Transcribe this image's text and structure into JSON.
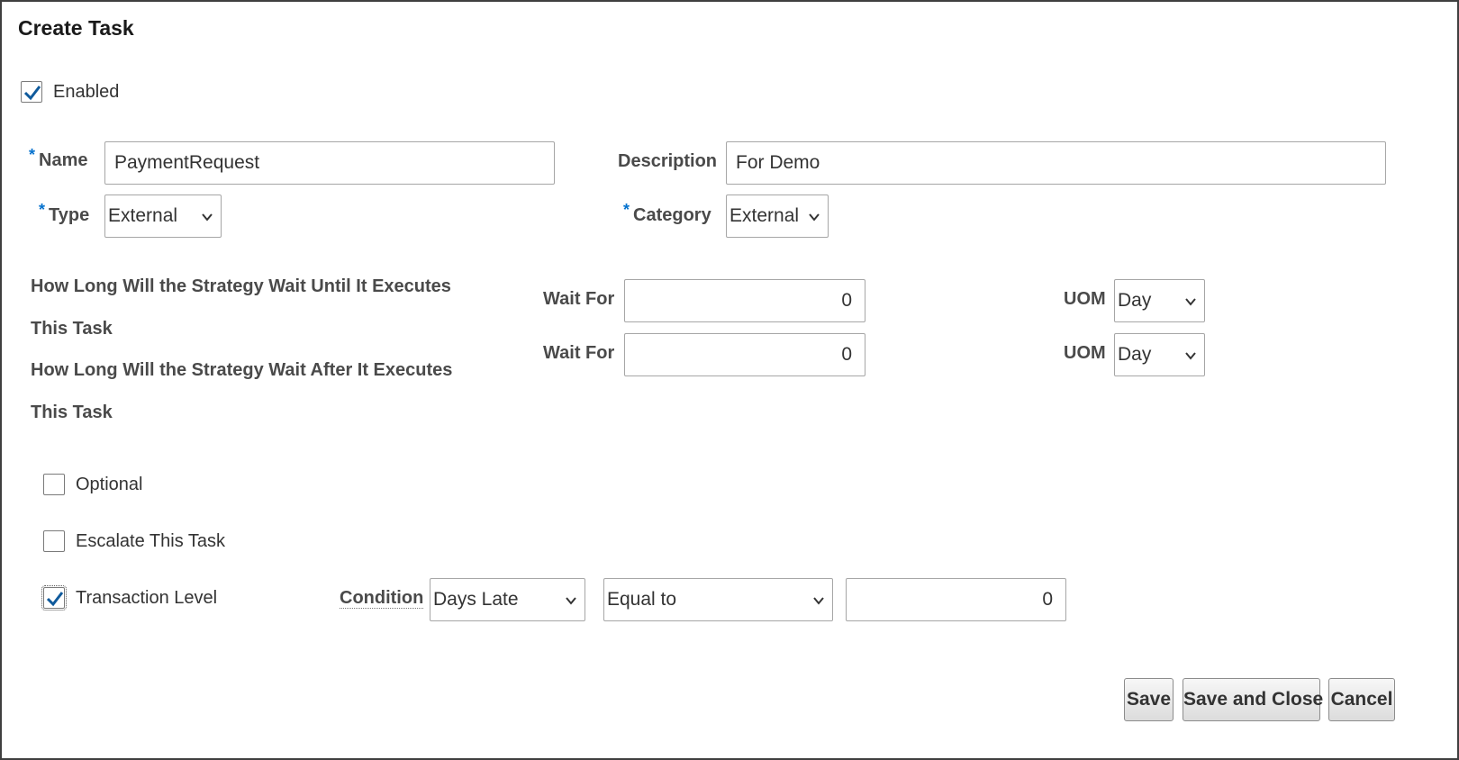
{
  "dialog": {
    "title": "Create Task"
  },
  "enabled": {
    "label": "Enabled",
    "checked": true
  },
  "name": {
    "label": "Name",
    "value": "PaymentRequest"
  },
  "description": {
    "label": "Description",
    "value": "For Demo"
  },
  "type": {
    "label": "Type",
    "value": "External"
  },
  "category": {
    "label": "Category",
    "value": "External"
  },
  "wait_before": {
    "text_line1": "How Long Will the Strategy Wait Until It Executes",
    "text_line2": "This Task",
    "wait_label": "Wait For",
    "wait_value": "0",
    "uom_label": "UOM",
    "uom_value": "Day"
  },
  "wait_after": {
    "text_line1": "How Long Will the Strategy Wait After It Executes",
    "text_line2": "This Task",
    "wait_label": "Wait For",
    "wait_value": "0",
    "uom_label": "UOM",
    "uom_value": "Day"
  },
  "optional": {
    "label": "Optional",
    "checked": false
  },
  "escalate": {
    "label": "Escalate This Task",
    "checked": false
  },
  "transaction_level": {
    "label": "Transaction Level",
    "checked": true
  },
  "condition": {
    "label": "Condition",
    "field_value": "Days Late",
    "operator_value": "Equal to",
    "amount_value": "0"
  },
  "buttons": {
    "save": "Save",
    "save_and_close": "Save and Close",
    "cancel": "Cancel"
  },
  "colors": {
    "check": "#0f5a9c",
    "required": "#0572ce"
  },
  "icons": {
    "checkmark": "checkmark-icon",
    "dropdown": "chevron-down-icon"
  }
}
